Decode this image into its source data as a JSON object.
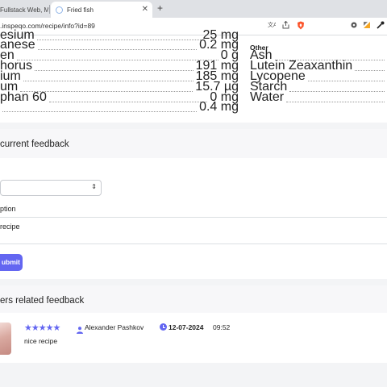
{
  "browser": {
    "tabs": [
      {
        "label": "Fullstack Web, Mo"
      },
      {
        "label": "Fried fish"
      }
    ],
    "url": ".inspeqo.com/recipe/info?id=89"
  },
  "nutrition": {
    "left_rows": [
      {
        "label": "esium",
        "value": "25 mg"
      },
      {
        "label": "anese",
        "value": "0.2 mg"
      },
      {
        "label": "en",
        "value": "0 g"
      },
      {
        "label": "horus",
        "value": "191 mg"
      },
      {
        "label": "ium",
        "value": "185 mg"
      },
      {
        "label": "um",
        "value": "15.7 µg"
      },
      {
        "label": "phan 60",
        "value": "0 mg"
      },
      {
        "label": "",
        "value": "0.4 mg"
      }
    ],
    "other_title": "Other",
    "right_rows": [
      {
        "label": "Ash"
      },
      {
        "label": "Lutein Zeaxanthin"
      },
      {
        "label": "Lycopene"
      },
      {
        "label": "Starch"
      },
      {
        "label": "Water"
      }
    ]
  },
  "feedback_form": {
    "title": "current feedback",
    "select_value": "",
    "description_label": "ption",
    "description_value": "recipe",
    "submit_label": "ubmit"
  },
  "related": {
    "title": "ers related feedback",
    "review": {
      "rating": "★★★★★",
      "rating_value": 5,
      "user": "Alexander Pashkov",
      "date": "12-07-2024",
      "time": "09:52",
      "comment": "nice recipe"
    }
  },
  "colors": {
    "accent": "#6366f1"
  }
}
